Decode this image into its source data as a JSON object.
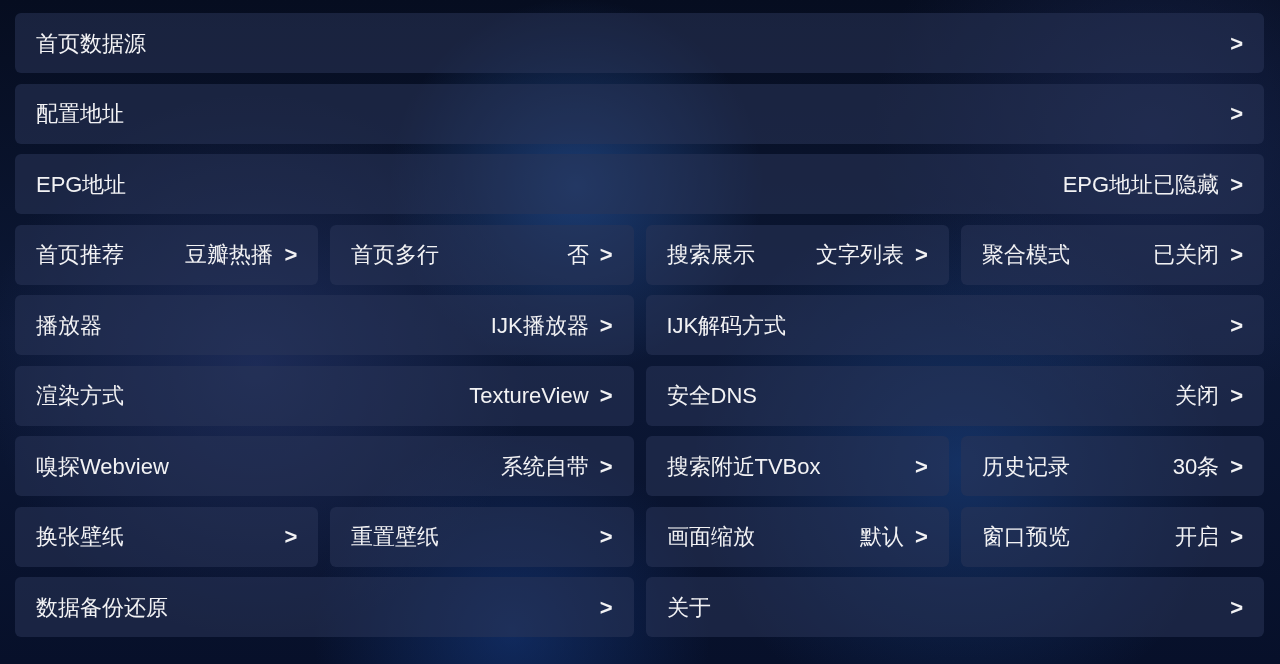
{
  "settings": [
    {
      "label": "首页数据源",
      "arrow": ">",
      "kind": "full"
    },
    {
      "label": "配置地址",
      "arrow": ">",
      "kind": "full"
    },
    {
      "label": "EPG地址",
      "value": "EPG地址已隐藏",
      "arrow": ">",
      "kind": "full"
    },
    {
      "label": "首页推荐",
      "value": "豆瓣热播",
      "arrow": ">",
      "kind": "quarter"
    },
    {
      "label": "首页多行",
      "value": "否",
      "arrow": ">",
      "kind": "quarter"
    },
    {
      "label": "搜索展示",
      "value": "文字列表",
      "arrow": ">",
      "kind": "quarter"
    },
    {
      "label": "聚合模式",
      "value": "已关闭",
      "arrow": ">",
      "kind": "quarter"
    },
    {
      "label": "播放器",
      "value": "IJK播放器",
      "arrow": ">",
      "kind": "half"
    },
    {
      "label": "IJK解码方式",
      "arrow": ">",
      "kind": "half"
    },
    {
      "label": "渲染方式",
      "value": "TextureView",
      "arrow": ">",
      "kind": "half"
    },
    {
      "label": "安全DNS",
      "value": "关闭",
      "arrow": ">",
      "kind": "half"
    },
    {
      "label": "嗅探Webview",
      "value": "系统自带",
      "arrow": ">",
      "kind": "half"
    },
    {
      "label": "搜索附近TVBox",
      "arrow": ">",
      "kind": "quarter"
    },
    {
      "label": "历史记录",
      "value": "30条",
      "arrow": ">",
      "kind": "quarter"
    },
    {
      "label": "换张壁纸",
      "arrow": ">",
      "kind": "quarter"
    },
    {
      "label": "重置壁纸",
      "arrow": ">",
      "kind": "quarter"
    },
    {
      "label": "画面缩放",
      "value": "默认",
      "arrow": ">",
      "kind": "quarter"
    },
    {
      "label": "窗口预览",
      "value": "开启",
      "arrow": ">",
      "kind": "quarter"
    },
    {
      "label": "数据备份还原",
      "arrow": ">",
      "kind": "half"
    },
    {
      "label": "关于",
      "arrow": ">",
      "kind": "half"
    }
  ]
}
